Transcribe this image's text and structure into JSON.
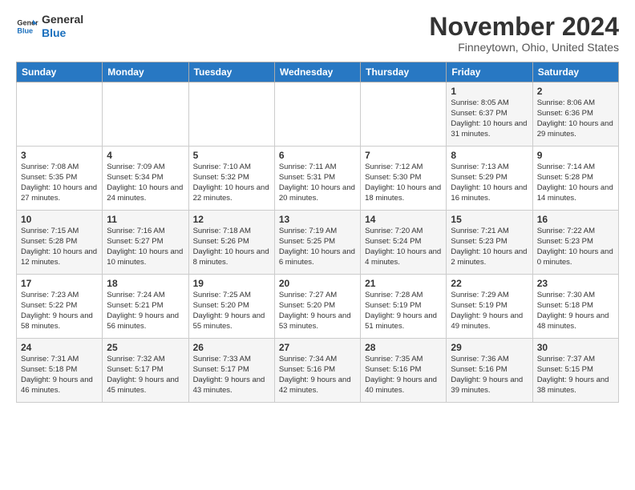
{
  "header": {
    "logo_line1": "General",
    "logo_line2": "Blue",
    "month": "November 2024",
    "location": "Finneytown, Ohio, United States"
  },
  "weekdays": [
    "Sunday",
    "Monday",
    "Tuesday",
    "Wednesday",
    "Thursday",
    "Friday",
    "Saturday"
  ],
  "weeks": [
    [
      {
        "day": "",
        "sunrise": "",
        "sunset": "",
        "daylight": ""
      },
      {
        "day": "",
        "sunrise": "",
        "sunset": "",
        "daylight": ""
      },
      {
        "day": "",
        "sunrise": "",
        "sunset": "",
        "daylight": ""
      },
      {
        "day": "",
        "sunrise": "",
        "sunset": "",
        "daylight": ""
      },
      {
        "day": "",
        "sunrise": "",
        "sunset": "",
        "daylight": ""
      },
      {
        "day": "1",
        "sunrise": "Sunrise: 8:05 AM",
        "sunset": "Sunset: 6:37 PM",
        "daylight": "Daylight: 10 hours and 31 minutes."
      },
      {
        "day": "2",
        "sunrise": "Sunrise: 8:06 AM",
        "sunset": "Sunset: 6:36 PM",
        "daylight": "Daylight: 10 hours and 29 minutes."
      }
    ],
    [
      {
        "day": "3",
        "sunrise": "Sunrise: 7:08 AM",
        "sunset": "Sunset: 5:35 PM",
        "daylight": "Daylight: 10 hours and 27 minutes."
      },
      {
        "day": "4",
        "sunrise": "Sunrise: 7:09 AM",
        "sunset": "Sunset: 5:34 PM",
        "daylight": "Daylight: 10 hours and 24 minutes."
      },
      {
        "day": "5",
        "sunrise": "Sunrise: 7:10 AM",
        "sunset": "Sunset: 5:32 PM",
        "daylight": "Daylight: 10 hours and 22 minutes."
      },
      {
        "day": "6",
        "sunrise": "Sunrise: 7:11 AM",
        "sunset": "Sunset: 5:31 PM",
        "daylight": "Daylight: 10 hours and 20 minutes."
      },
      {
        "day": "7",
        "sunrise": "Sunrise: 7:12 AM",
        "sunset": "Sunset: 5:30 PM",
        "daylight": "Daylight: 10 hours and 18 minutes."
      },
      {
        "day": "8",
        "sunrise": "Sunrise: 7:13 AM",
        "sunset": "Sunset: 5:29 PM",
        "daylight": "Daylight: 10 hours and 16 minutes."
      },
      {
        "day": "9",
        "sunrise": "Sunrise: 7:14 AM",
        "sunset": "Sunset: 5:28 PM",
        "daylight": "Daylight: 10 hours and 14 minutes."
      }
    ],
    [
      {
        "day": "10",
        "sunrise": "Sunrise: 7:15 AM",
        "sunset": "Sunset: 5:28 PM",
        "daylight": "Daylight: 10 hours and 12 minutes."
      },
      {
        "day": "11",
        "sunrise": "Sunrise: 7:16 AM",
        "sunset": "Sunset: 5:27 PM",
        "daylight": "Daylight: 10 hours and 10 minutes."
      },
      {
        "day": "12",
        "sunrise": "Sunrise: 7:18 AM",
        "sunset": "Sunset: 5:26 PM",
        "daylight": "Daylight: 10 hours and 8 minutes."
      },
      {
        "day": "13",
        "sunrise": "Sunrise: 7:19 AM",
        "sunset": "Sunset: 5:25 PM",
        "daylight": "Daylight: 10 hours and 6 minutes."
      },
      {
        "day": "14",
        "sunrise": "Sunrise: 7:20 AM",
        "sunset": "Sunset: 5:24 PM",
        "daylight": "Daylight: 10 hours and 4 minutes."
      },
      {
        "day": "15",
        "sunrise": "Sunrise: 7:21 AM",
        "sunset": "Sunset: 5:23 PM",
        "daylight": "Daylight: 10 hours and 2 minutes."
      },
      {
        "day": "16",
        "sunrise": "Sunrise: 7:22 AM",
        "sunset": "Sunset: 5:23 PM",
        "daylight": "Daylight: 10 hours and 0 minutes."
      }
    ],
    [
      {
        "day": "17",
        "sunrise": "Sunrise: 7:23 AM",
        "sunset": "Sunset: 5:22 PM",
        "daylight": "Daylight: 9 hours and 58 minutes."
      },
      {
        "day": "18",
        "sunrise": "Sunrise: 7:24 AM",
        "sunset": "Sunset: 5:21 PM",
        "daylight": "Daylight: 9 hours and 56 minutes."
      },
      {
        "day": "19",
        "sunrise": "Sunrise: 7:25 AM",
        "sunset": "Sunset: 5:20 PM",
        "daylight": "Daylight: 9 hours and 55 minutes."
      },
      {
        "day": "20",
        "sunrise": "Sunrise: 7:27 AM",
        "sunset": "Sunset: 5:20 PM",
        "daylight": "Daylight: 9 hours and 53 minutes."
      },
      {
        "day": "21",
        "sunrise": "Sunrise: 7:28 AM",
        "sunset": "Sunset: 5:19 PM",
        "daylight": "Daylight: 9 hours and 51 minutes."
      },
      {
        "day": "22",
        "sunrise": "Sunrise: 7:29 AM",
        "sunset": "Sunset: 5:19 PM",
        "daylight": "Daylight: 9 hours and 49 minutes."
      },
      {
        "day": "23",
        "sunrise": "Sunrise: 7:30 AM",
        "sunset": "Sunset: 5:18 PM",
        "daylight": "Daylight: 9 hours and 48 minutes."
      }
    ],
    [
      {
        "day": "24",
        "sunrise": "Sunrise: 7:31 AM",
        "sunset": "Sunset: 5:18 PM",
        "daylight": "Daylight: 9 hours and 46 minutes."
      },
      {
        "day": "25",
        "sunrise": "Sunrise: 7:32 AM",
        "sunset": "Sunset: 5:17 PM",
        "daylight": "Daylight: 9 hours and 45 minutes."
      },
      {
        "day": "26",
        "sunrise": "Sunrise: 7:33 AM",
        "sunset": "Sunset: 5:17 PM",
        "daylight": "Daylight: 9 hours and 43 minutes."
      },
      {
        "day": "27",
        "sunrise": "Sunrise: 7:34 AM",
        "sunset": "Sunset: 5:16 PM",
        "daylight": "Daylight: 9 hours and 42 minutes."
      },
      {
        "day": "28",
        "sunrise": "Sunrise: 7:35 AM",
        "sunset": "Sunset: 5:16 PM",
        "daylight": "Daylight: 9 hours and 40 minutes."
      },
      {
        "day": "29",
        "sunrise": "Sunrise: 7:36 AM",
        "sunset": "Sunset: 5:16 PM",
        "daylight": "Daylight: 9 hours and 39 minutes."
      },
      {
        "day": "30",
        "sunrise": "Sunrise: 7:37 AM",
        "sunset": "Sunset: 5:15 PM",
        "daylight": "Daylight: 9 hours and 38 minutes."
      }
    ]
  ]
}
